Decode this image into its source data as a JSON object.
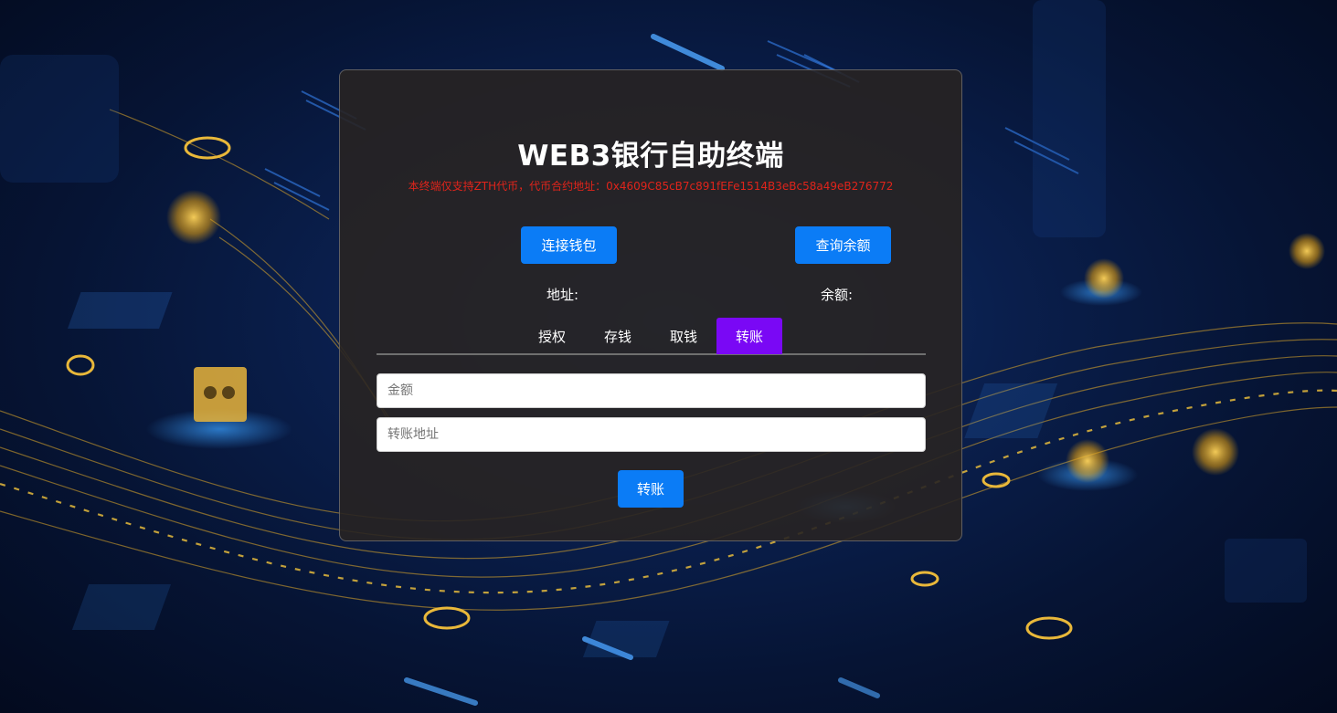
{
  "terminal": {
    "title": "WEB3银行自助终端",
    "notice": "本终端仅支持ZTH代币，代币合约地址：0x4609C85cB7c891fEFe1514B3eBc58a49eB276772",
    "connect_wallet_label": "连接钱包",
    "check_balance_label": "查询余额",
    "address_label": "地址:",
    "balance_label": "余额:"
  },
  "tabs": [
    {
      "label": "授权",
      "active": false
    },
    {
      "label": "存钱",
      "active": false
    },
    {
      "label": "取钱",
      "active": false
    },
    {
      "label": "转账",
      "active": true
    }
  ],
  "form": {
    "amount_placeholder": "金额",
    "amount_value": "",
    "address_placeholder": "转账地址",
    "address_value": "",
    "submit_label": "转账"
  },
  "colors": {
    "primary_button": "#0b7cf6",
    "active_tab": "#7a08f5",
    "notice_text": "#e0241b"
  }
}
